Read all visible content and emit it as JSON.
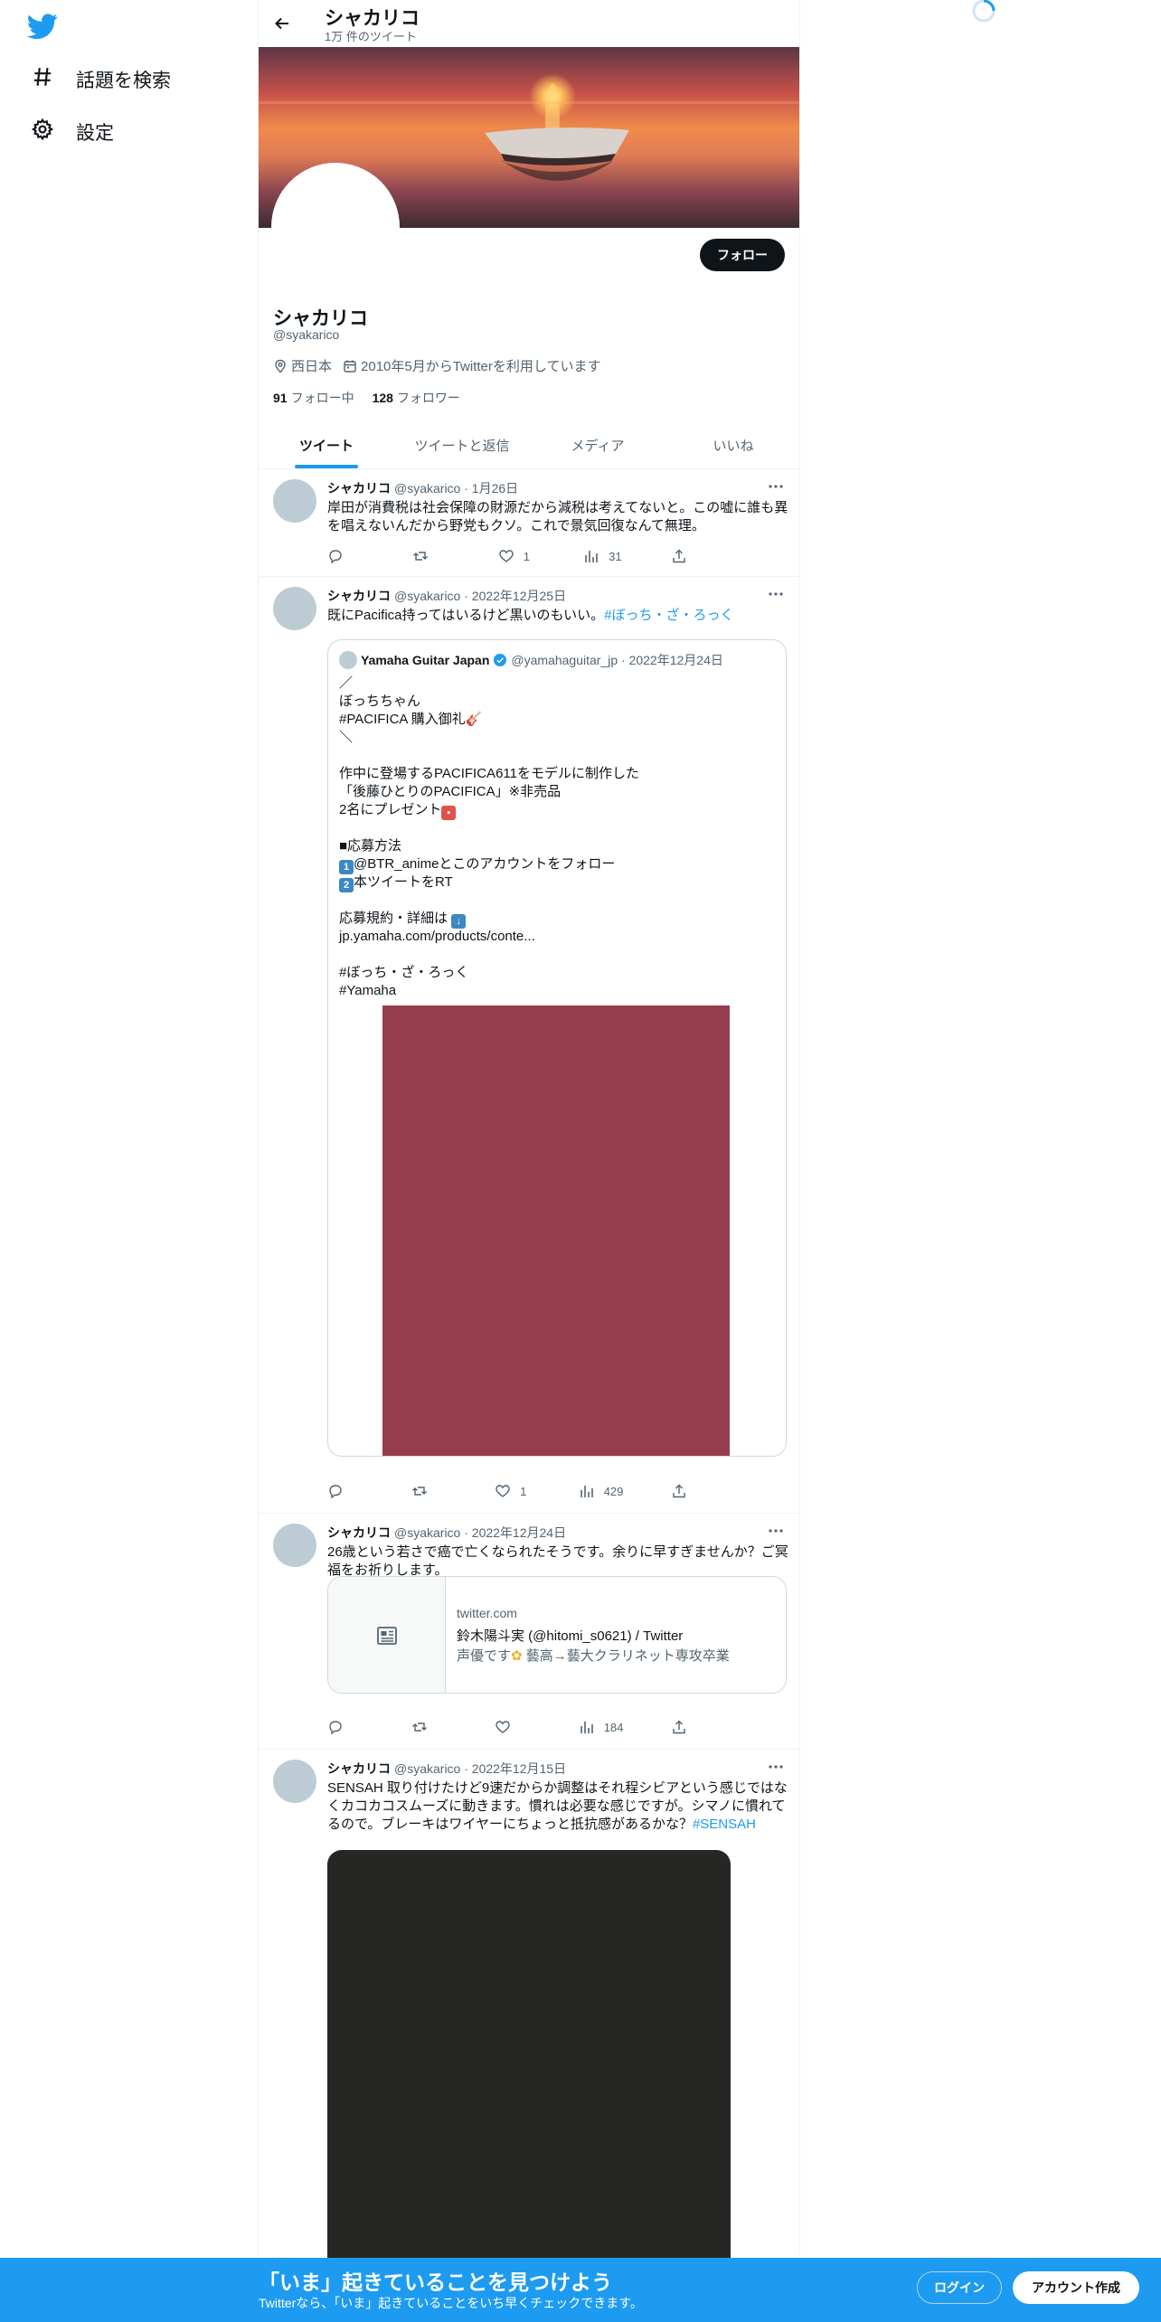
{
  "sidebar": {
    "logo_icon": "twitter-bird-icon",
    "items": [
      {
        "label": "話題を検索",
        "icon": "hashtag-icon"
      },
      {
        "label": "設定",
        "icon": "gear-icon"
      }
    ]
  },
  "header": {
    "name": "シャカリコ",
    "tweet_count": "1万 件のツイート"
  },
  "profile": {
    "follow_label": "フォロー",
    "name": "シャカリコ",
    "handle": "@syakarico",
    "location": "西日本",
    "joined": "2010年5月からTwitterを利用しています",
    "following_count": "91",
    "following_label": "フォロー中",
    "followers_count": "128",
    "followers_label": "フォロワー"
  },
  "tabs": [
    {
      "label": "ツイート",
      "active": true
    },
    {
      "label": "ツイートと返信",
      "active": false
    },
    {
      "label": "メディア",
      "active": false
    },
    {
      "label": "いいね",
      "active": false
    }
  ],
  "tweets": [
    {
      "name": "シャカリコ",
      "meta": "@syakarico · 1月26日",
      "text": "岸田が消費税は社会保障の財源だから減税は考えてないと。この嘘に誰も異を唱えないんだから野党もクソ。これで景気回復なんて無理。",
      "likes": "1",
      "views": "31"
    },
    {
      "name": "シャカリコ",
      "meta": "@syakarico · 2022年12月25日",
      "text": "既にPacifica持ってはいるけど黒いのもいい。",
      "hashtag": "#ぼっち・ざ・ろっく",
      "likes": "1",
      "views": "429",
      "quote": {
        "name": "Yamaha Guitar Japan",
        "meta": "@yamahaguitar_jp · 2022年12月24日",
        "lines": [
          "／",
          "ぼっちちゃん",
          "#PACIFICA 購入御礼",
          "＼",
          "",
          "作中に登場するPACIFICA611をモデルに制作した",
          "「後藤ひとりのPACIFICA」※非売品",
          "2名にプレゼント",
          "",
          "■応募方法",
          "@BTR_animeとこのアカウントをフォロー",
          "本ツイートをRT",
          "",
          "応募規約・詳細は",
          "jp.yamaha.com/products/conte...",
          "",
          "#ぼっち・ざ・ろっく",
          "#Yamaha"
        ],
        "media_color": "#973c4c"
      }
    },
    {
      "name": "シャカリコ",
      "meta": "@syakarico · 2022年12月24日",
      "text": "26歳という若さで癌で亡くなられたそうです。余りに早すぎませんか？ご冥福をお祈りします。",
      "likes": "",
      "views": "184",
      "card": {
        "domain": "twitter.com",
        "title": "鈴木陽斗実 (@hitomi_s0621) / Twitter",
        "desc_a": "声優です",
        "desc_b": "藝高→藝大クラリネット専攻卒業"
      }
    },
    {
      "name": "シャカリコ",
      "meta": "@syakarico · 2022年12月15日",
      "text": "SENSAH 取り付けたけど9速だからか調整はそれ程シビアという感じではなくカコカコスムーズに動きます。慣れは必要な感じですが。シマノに慣れてるので。ブレーキはワイヤーにちょっと抵抗感があるかな？",
      "hashtag": "#SENSAH",
      "media_color": "#262725"
    }
  ],
  "bottom": {
    "title": "「いま」起きていることを見つけよう",
    "subtitle": "Twitterなら、「いま」起きていることをいち早くチェックできます。",
    "login": "ログイン",
    "signup": "アカウント作成"
  },
  "colors": {
    "accent": "#1d9bf0",
    "text": "#0f1419",
    "muted": "#536471",
    "border": "#eff3f4"
  }
}
